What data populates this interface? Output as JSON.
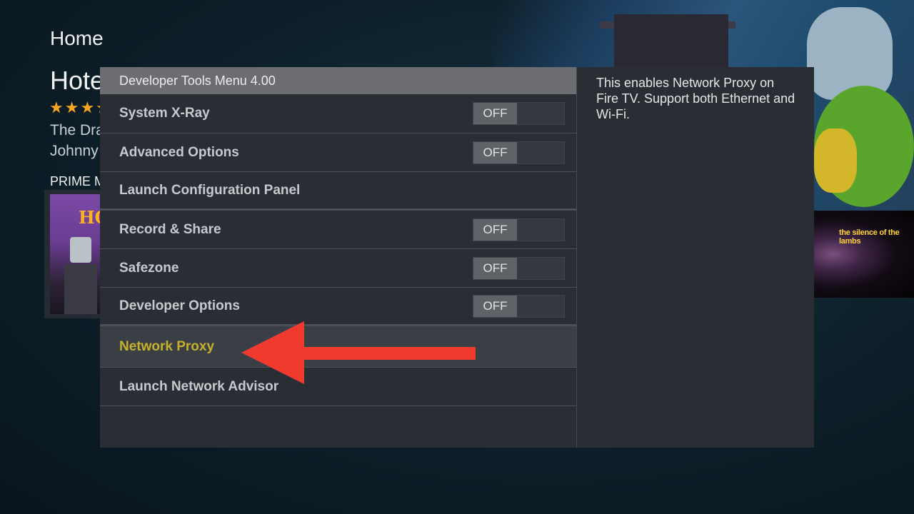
{
  "background": {
    "page_title": "Home",
    "movie_title": "Hote",
    "stars": "★★★★",
    "desc_line1": "The Dra",
    "desc_line2": "Johnny",
    "section_label": "PRIME M",
    "poster_logo": "HO",
    "lambs_text": "the silence of the lambs"
  },
  "dialog": {
    "header": "Developer Tools Menu 4.00",
    "items": [
      {
        "label": "System X-Ray",
        "toggle": "OFF"
      },
      {
        "label": "Advanced Options",
        "toggle": "OFF"
      },
      {
        "label": "Launch Configuration Panel"
      },
      {
        "label": "Record & Share",
        "toggle": "OFF"
      },
      {
        "label": "Safezone",
        "toggle": "OFF"
      },
      {
        "label": "Developer Options",
        "toggle": "OFF"
      },
      {
        "label": "Network Proxy",
        "selected": true
      },
      {
        "label": "Launch Network Advisor"
      }
    ],
    "help_text": "This enables Network Proxy on Fire TV. Support both Ethernet and Wi-Fi."
  },
  "colors": {
    "selected_text": "#c6b12c",
    "arrow": "#f03a2e",
    "star": "#f7a623"
  },
  "icons": {
    "arrow": "left-arrow-annotation"
  }
}
